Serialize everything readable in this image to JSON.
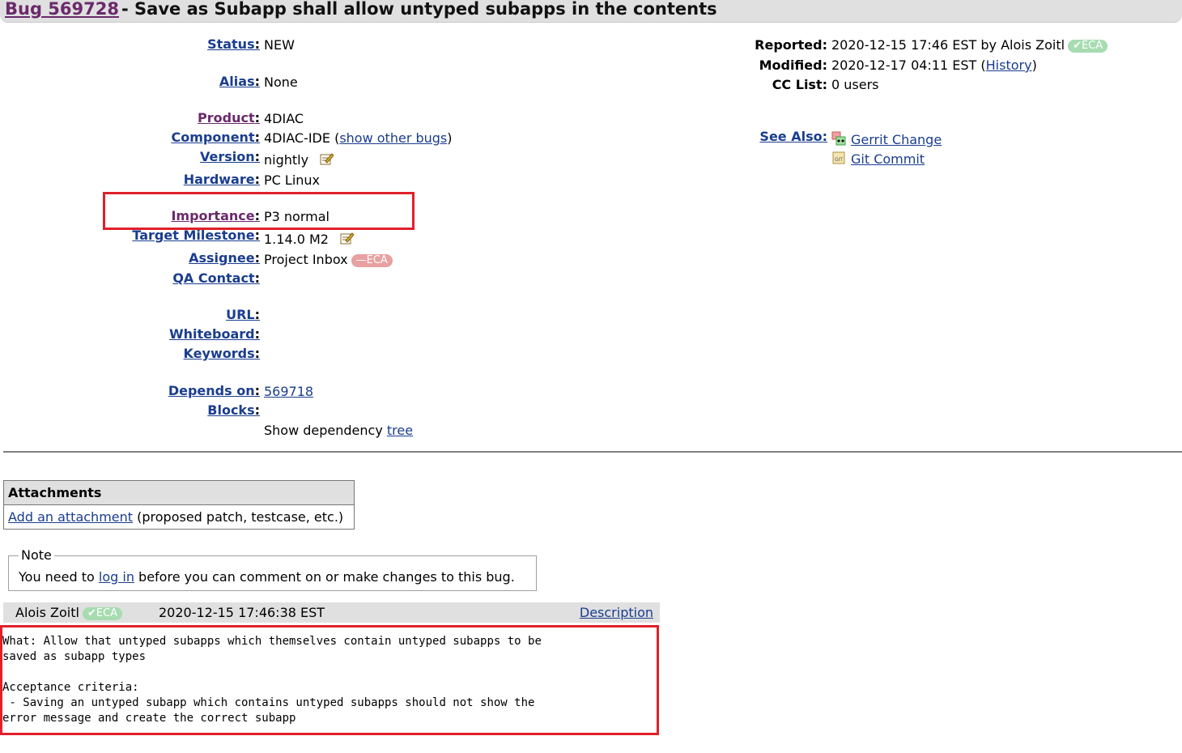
{
  "header": {
    "bug_link": "Bug 569728",
    "title": "- Save as Subapp shall allow untyped subapps in the contents"
  },
  "fields": {
    "status": {
      "label": "Status",
      "value": "NEW"
    },
    "alias": {
      "label": "Alias",
      "value": "None"
    },
    "product": {
      "label": "Product",
      "value": "4DIAC"
    },
    "component": {
      "label": "Component",
      "value": "4DIAC-IDE",
      "open": "(",
      "link": "show other bugs",
      "close": ")"
    },
    "version": {
      "label": "Version",
      "value": "nightly"
    },
    "hardware": {
      "label": "Hardware",
      "value": "PC Linux"
    },
    "importance": {
      "label": "Importance",
      "value": "P3 normal"
    },
    "target_milestone": {
      "label": "Target Milestone",
      "value": "1.14.0 M2"
    },
    "assignee": {
      "label": "Assignee",
      "value": "Project Inbox",
      "badge": "ECA"
    },
    "qa_contact": {
      "label": "QA Contact"
    },
    "url": {
      "label": "URL"
    },
    "whiteboard": {
      "label": "Whiteboard"
    },
    "keywords": {
      "label": "Keywords"
    },
    "depends_on": {
      "label": "Depends on",
      "value": "569718"
    },
    "blocks": {
      "label": "Blocks"
    },
    "dependency": {
      "text": "Show dependency",
      "link": "tree"
    },
    "colon": ":"
  },
  "right": {
    "reported": {
      "label": "Reported:",
      "value": "2020-12-15 17:46 EST by Alois Zoitl",
      "badge": "ECA"
    },
    "modified": {
      "label": "Modified:",
      "value": "2020-12-17 04:11 EST (",
      "link": "History",
      "close": ")"
    },
    "cc_list": {
      "label": "CC List:",
      "value": "0 users"
    },
    "see_also": {
      "label": "See Also:",
      "gerrit": "Gerrit Change",
      "git": "Git Commit",
      "git_icon_text": "GIT"
    }
  },
  "attachments": {
    "heading": "Attachments",
    "add_link": "Add an attachment",
    "hint": "(proposed patch, testcase, etc.)"
  },
  "note": {
    "legend": "Note",
    "before": "You need to",
    "link": "log in",
    "after": "before you can comment on or make changes to this bug."
  },
  "comment": {
    "author": "Alois Zoitl",
    "badge": "ECA",
    "timestamp": "2020-12-15 17:46:38 EST",
    "desc_link": "Description",
    "text": "What: Allow that untyped subapps which themselves contain untyped subapps to be\nsaved as subapp types\n\nAcceptance criteria:\n - Saving an untyped subapp which contains untyped subapps should not show the\nerror message and create the correct subapp"
  },
  "colors": {
    "link": "#1a3d8f",
    "visited": "#6b2a6b",
    "highlight": "#e0202a",
    "eca_ok": "#a6dcb0",
    "eca_bad": "#e8a0a0"
  }
}
